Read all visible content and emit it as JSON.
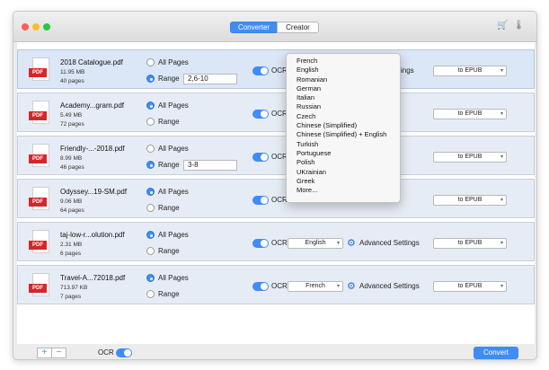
{
  "tabs": [
    "Converter",
    "Creator"
  ],
  "toolbar_icons": [
    "cart-icon",
    "thermometer-icon"
  ],
  "page_options": {
    "all": "All Pages",
    "range": "Range"
  },
  "ocr_label": "OCR",
  "advanced_label": "Advanced Settings",
  "files": [
    {
      "name": "2018 Catalogue.pdf",
      "size": "11.95 MB",
      "pages": "40 pages",
      "page_mode": "range",
      "range": "2,6-10",
      "output": "to EPUB"
    },
    {
      "name": "Academy...gram.pdf",
      "size": "5.49 MB",
      "pages": "72 pages",
      "page_mode": "all",
      "range": "",
      "output": "to EPUB"
    },
    {
      "name": "Friendly-...-2018.pdf",
      "size": "8.99 MB",
      "pages": "46 pages",
      "page_mode": "range",
      "range": "3-8",
      "output": "to EPUB"
    },
    {
      "name": "Odyssey...19-SM.pdf",
      "size": "9.06 MB",
      "pages": "64 pages",
      "page_mode": "all",
      "range": "",
      "output": "to EPUB"
    },
    {
      "name": "taj-low-r...olution.pdf",
      "size": "2.31 MB",
      "pages": "6 pages",
      "page_mode": "all",
      "range": "",
      "language": "English",
      "output": "to EPUB"
    },
    {
      "name": "Travel-A...72018.pdf",
      "size": "713.97 KB",
      "pages": "7 pages",
      "page_mode": "all",
      "range": "",
      "language": "French",
      "output": "to EPUB"
    }
  ],
  "language_dropdown": [
    "French",
    "English",
    "Romanian",
    "German",
    "Italian",
    "Russian",
    "Czech",
    "Chinese (Simplified)",
    "Chinese (Simplified) + English",
    "Turkish",
    "Portuguese",
    "Polish",
    "UKrainian",
    "Greek",
    "More..."
  ],
  "footer": {
    "add": "+",
    "remove": "−",
    "ocr": "OCR",
    "convert": "Convert"
  },
  "colors": {
    "accent": "#3f8cf5",
    "pdf_red": "#d5262a",
    "row_bg": "#e6ecf5"
  }
}
